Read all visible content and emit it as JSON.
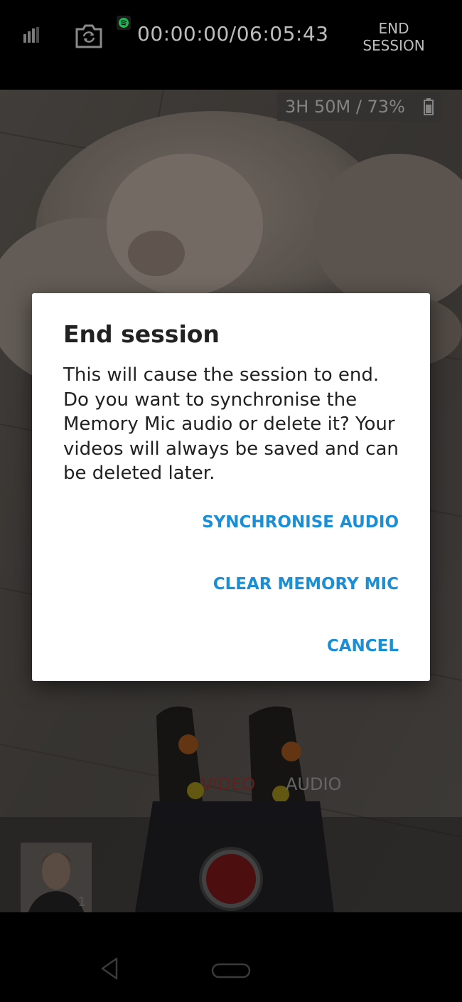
{
  "topbar": {
    "timer": "00:00:00/06:05:43",
    "end_session_label": "END\nSESSION",
    "icons": [
      "signal-icon",
      "camera-switch-icon",
      "spotify-icon"
    ]
  },
  "camera": {
    "battery_status": "3H 50M / 73%",
    "modes": {
      "video": "VIDEO",
      "audio": "AUDIO"
    },
    "thumbnail_count": "1"
  },
  "dialog": {
    "title": "End session",
    "message": "This will cause the session to end. Do you want to synchronise the Memory Mic audio or delete it? Your videos will always be saved and can be deleted later.",
    "actions": {
      "synchronise": "SYNCHRONISE AUDIO",
      "clear": "CLEAR MEMORY MIC",
      "cancel": "CANCEL"
    }
  },
  "colors": {
    "accent": "#1a8fd6",
    "record": "#6a1414",
    "video_mode": "#8a2a2a"
  }
}
